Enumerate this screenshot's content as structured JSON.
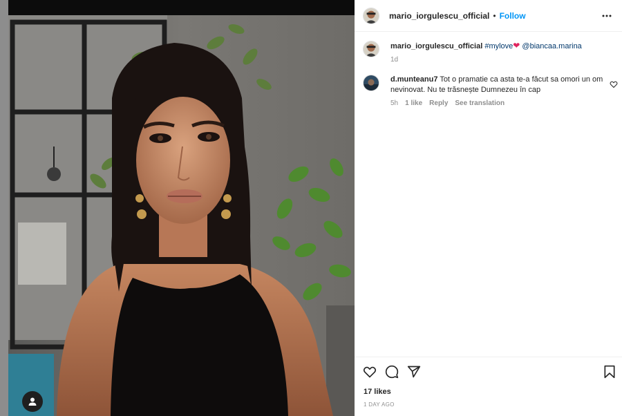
{
  "post": {
    "author": "mario_iorgulescu_official",
    "separator": "•",
    "follow_label": "Follow",
    "more_icon": "more-horizontal-icon"
  },
  "caption": {
    "username": "mario_iorgulescu_official",
    "hashtag": "#mylove",
    "heart": "❤",
    "mention": "@biancaa.marina",
    "time": "1d"
  },
  "comments": [
    {
      "username": "d.munteanu7",
      "text": "Tot o pramatie ca asta te-a făcut sa omori un om nevinovat. Nu te trăsnește Dumnezeu în cap",
      "time": "5h",
      "likes": "1 like",
      "reply_label": "Reply",
      "translate_label": "See translation"
    }
  ],
  "actions": {
    "like_icon": "heart-icon",
    "comment_icon": "comment-icon",
    "share_icon": "share-icon",
    "save_icon": "bookmark-icon"
  },
  "likes_text": "17 likes",
  "posted_ago": "1 DAY AGO",
  "colors": {
    "link": "#0095f6",
    "text": "#262626",
    "muted": "#8e8e8e",
    "mention": "#00376b"
  }
}
